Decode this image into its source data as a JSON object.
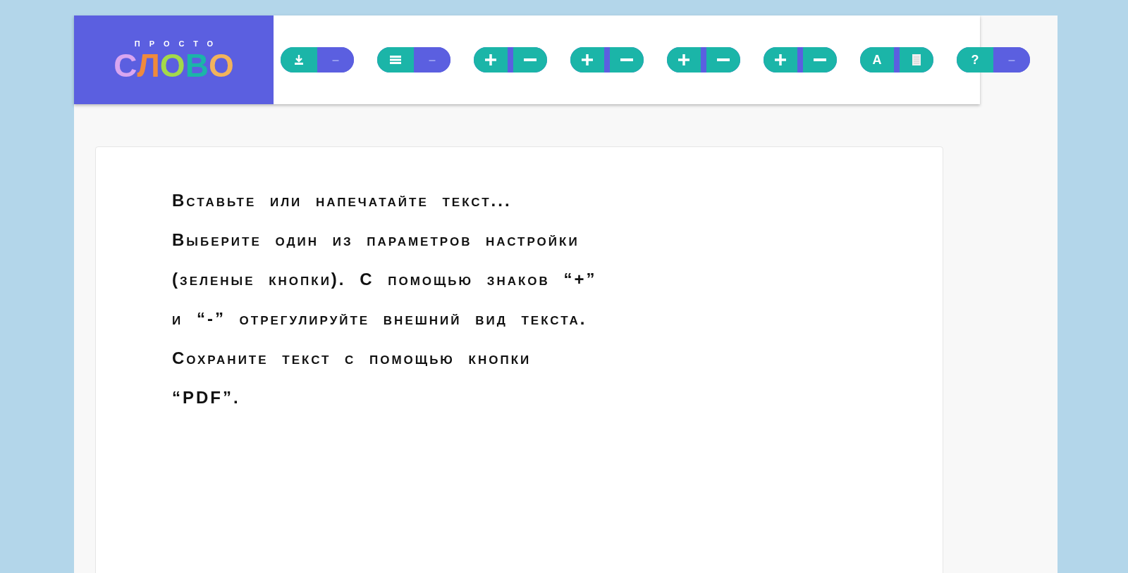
{
  "logo": {
    "tagline": "ПРОСТО",
    "letters": [
      {
        "char": "С",
        "color": "#d9a6f0"
      },
      {
        "char": "Л",
        "color": "#f08a3c"
      },
      {
        "char": "О",
        "color": "#a3d94a"
      },
      {
        "char": "В",
        "color": "#1bb5a8"
      },
      {
        "char": "О",
        "color": "#f2b35c"
      }
    ]
  },
  "toolbar": [
    {
      "left": {
        "kind": "download",
        "on": true
      },
      "right": {
        "kind": "text",
        "label": "–",
        "on": false
      }
    },
    {
      "left": {
        "kind": "menu",
        "on": true
      },
      "right": {
        "kind": "text",
        "label": "–",
        "on": false
      }
    },
    {
      "left": {
        "kind": "plus",
        "on": true
      },
      "right": {
        "kind": "minus",
        "on": true
      }
    },
    {
      "left": {
        "kind": "plus",
        "on": true
      },
      "right": {
        "kind": "minus",
        "on": true
      }
    },
    {
      "left": {
        "kind": "plus",
        "on": true
      },
      "right": {
        "kind": "minus",
        "on": true
      }
    },
    {
      "left": {
        "kind": "plus",
        "on": true
      },
      "right": {
        "kind": "minus",
        "on": true
      }
    },
    {
      "left": {
        "kind": "text",
        "label": "A",
        "on": true
      },
      "right": {
        "kind": "page",
        "on": true
      }
    },
    {
      "left": {
        "kind": "text",
        "label": "?",
        "on": true
      },
      "right": {
        "kind": "text",
        "label": "–",
        "on": false
      }
    }
  ],
  "editor": {
    "placeholder": "Вставьте или напечатайте текст...\nВыберите один из параметров настройки\n(зеленые кнопки). С помощью знаков “+”\nи “-” отрегулируйте внешний вид текста.\nСохраните текст с помощью кнопки\n“PDF”."
  }
}
